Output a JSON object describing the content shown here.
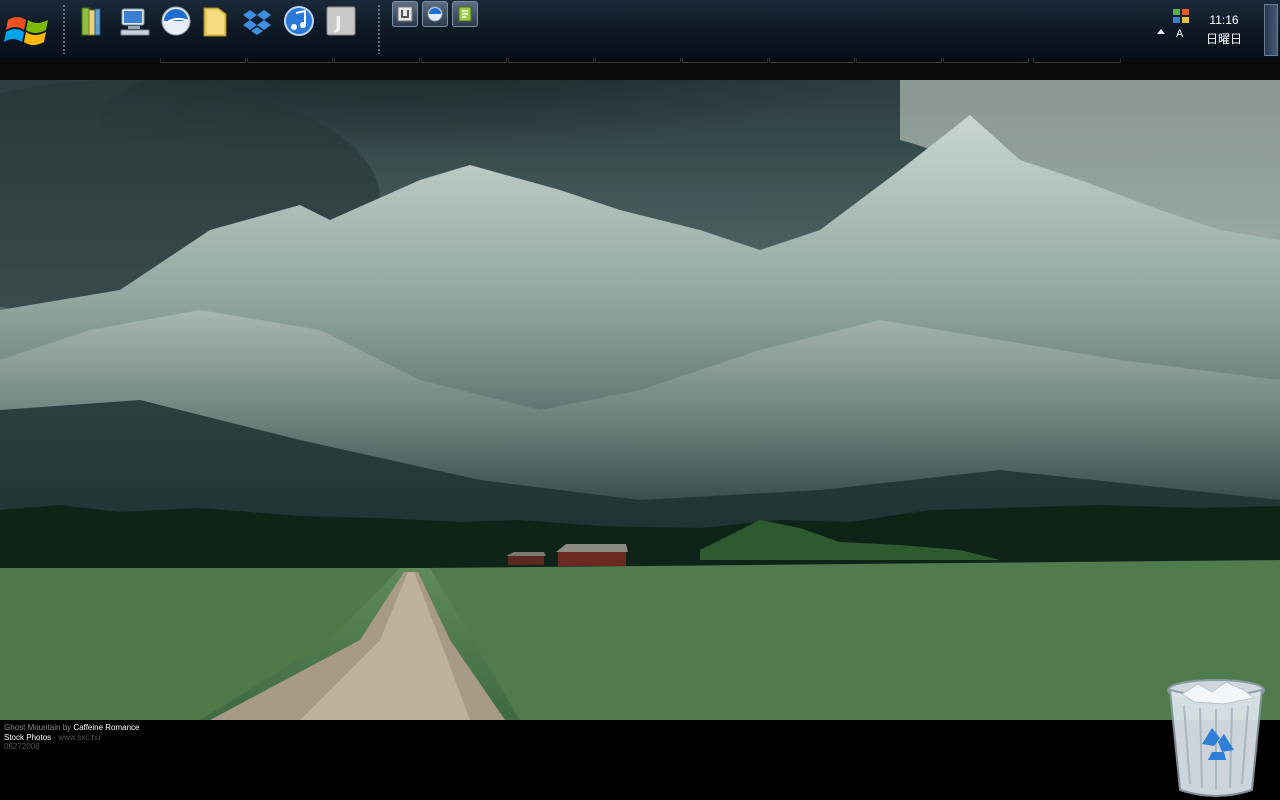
{
  "taskbar": {
    "quick_launch": [
      {
        "name": "books-icon"
      },
      {
        "name": "computer-icon"
      },
      {
        "name": "browser-icon"
      },
      {
        "name": "folder-icon"
      },
      {
        "name": "dropbox-icon"
      },
      {
        "name": "itunes-icon"
      },
      {
        "name": "j-app-icon"
      }
    ],
    "window_buttons": [
      {
        "name": "app-window-icon"
      },
      {
        "name": "browser-window-icon"
      },
      {
        "name": "notepad-window-icon"
      }
    ],
    "tray": {
      "time": "11:16",
      "day": "日曜日",
      "ime": "A"
    }
  },
  "wallpaper": {
    "caption": {
      "line1_prefix": "Ghost Mountain by",
      "line1_author": "Caffeine Romance",
      "line2_label": "Stock Photos",
      "line2_site": "- www.sxc.hu",
      "line3_date": "06272008"
    }
  },
  "colors": {
    "taskbar": "#0f1a26",
    "sky": "#2f4a4c",
    "grass": "#4f7b4d"
  }
}
